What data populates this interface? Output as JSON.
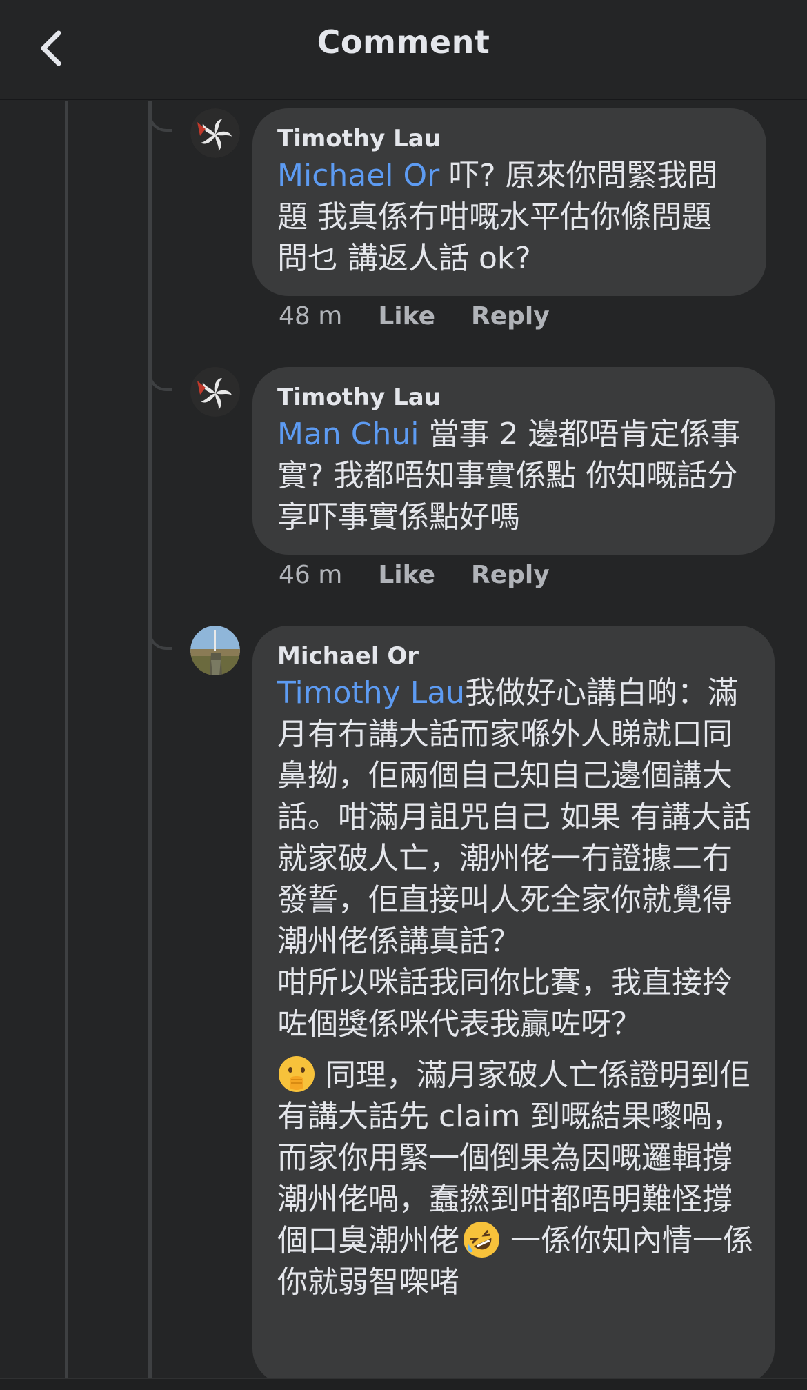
{
  "header": {
    "title": "Comment",
    "back_icon": "chevron-left-icon"
  },
  "comments": [
    {
      "author": "Timothy Lau",
      "mention": "Michael Or",
      "text": " 吓? 原來你問緊我問題 我真係冇咁嘅水平估你條問題問乜 講返人話 ok?",
      "time": "48 m",
      "like_label": "Like",
      "reply_label": "Reply",
      "avatar_icon": "bauhinia-flag-avatar"
    },
    {
      "author": "Timothy Lau",
      "mention": "Man Chui",
      "text": " 當事 2 邊都唔肯定係事實? 我都唔知事實係點 你知嘅話分享吓事實係點好嗎",
      "time": "46 m",
      "like_label": "Like",
      "reply_label": "Reply",
      "avatar_icon": "bauhinia-flag-avatar"
    },
    {
      "author": "Michael Or",
      "mention": "Timothy Lau",
      "text": "我做好心講白啲：滿月有冇講大話而家喺外人睇就口同鼻拗，佢兩個自己知自己邊個講大話。咁滿月詛咒自己 如果 有講大話就家破人亡，潮州佬一冇證據二冇發誓，佢直接叫人死全家你就覺得潮州佬係講真話？\n咁所以咪話我同你比賽，我直接拎咗個獎係咪代表我贏咗呀？",
      "text2": " 同理，滿月家破人亡係證明到佢有講大話先 claim 到嘅結果嚟喎，而家你用緊一個倒果為因嘅邏輯撐潮州佬喎，蠢撚到咁都唔明難怪撐個口臭潮州佬",
      "text3": " 一係你知內情一係你就弱智㗎啫",
      "emoji1": "face-with-hand-over-mouth-icon",
      "emoji2": "rolling-on-floor-laughing-icon",
      "avatar_icon": "landscape-photo-avatar"
    }
  ],
  "colors": {
    "background": "#242526",
    "bubble": "#3a3b3c",
    "mention": "#5d9bf2",
    "meta_text": "#b0b3b8"
  }
}
